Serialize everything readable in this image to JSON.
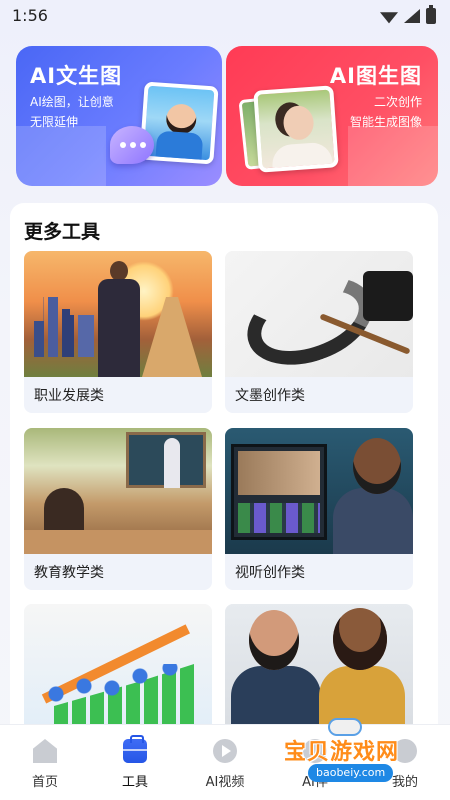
{
  "status": {
    "time": "1:56"
  },
  "banners": {
    "left": {
      "title": "AI文生图",
      "subtitle_line1": "AI绘图，让创意",
      "subtitle_line2": "无限延伸"
    },
    "right": {
      "title": "AI图生图",
      "subtitle_line1": "二次创作",
      "subtitle_line2": "智能生成图像"
    }
  },
  "tools": {
    "title": "更多工具",
    "items": [
      {
        "label": "职业发展类"
      },
      {
        "label": "文墨创作类"
      },
      {
        "label": "教育教学类"
      },
      {
        "label": "视听创作类"
      },
      {
        "label": ""
      },
      {
        "label": ""
      }
    ]
  },
  "nav": {
    "items": [
      {
        "label": "首页",
        "icon": "home-icon"
      },
      {
        "label": "工具",
        "icon": "toolbox-icon"
      },
      {
        "label": "AI视频",
        "icon": "play-icon"
      },
      {
        "label": "AI伴",
        "icon": "ai-icon"
      },
      {
        "label": "我的",
        "icon": "profile-icon"
      }
    ]
  },
  "watermark": {
    "text": "宝贝游戏网",
    "url": "baobeiy.com"
  },
  "colors": {
    "accent": "#2556e6",
    "banner_left": "#4a67f5",
    "banner_right": "#ff3b55",
    "watermark": "#ff8c1a"
  }
}
